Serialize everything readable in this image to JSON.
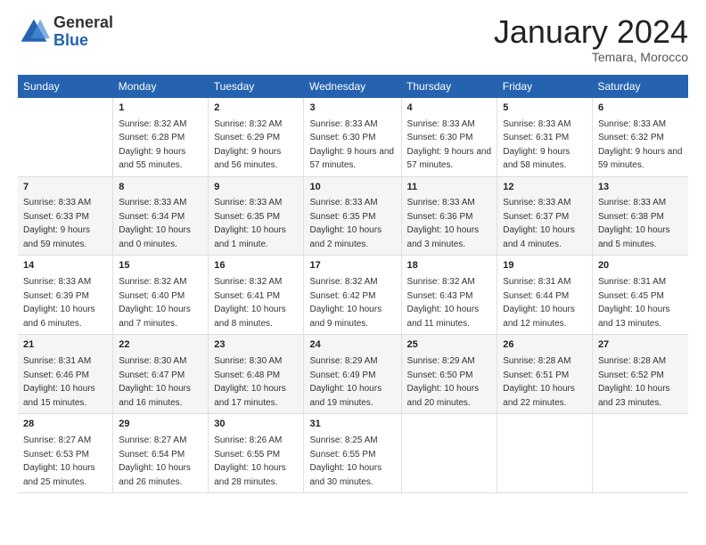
{
  "header": {
    "logo_general": "General",
    "logo_blue": "Blue",
    "month_title": "January 2024",
    "subtitle": "Temara, Morocco"
  },
  "days_of_week": [
    "Sunday",
    "Monday",
    "Tuesday",
    "Wednesday",
    "Thursday",
    "Friday",
    "Saturday"
  ],
  "weeks": [
    [
      {
        "day": "",
        "sunrise": "",
        "sunset": "",
        "daylight": ""
      },
      {
        "day": "1",
        "sunrise": "Sunrise: 8:32 AM",
        "sunset": "Sunset: 6:28 PM",
        "daylight": "Daylight: 9 hours and 55 minutes."
      },
      {
        "day": "2",
        "sunrise": "Sunrise: 8:32 AM",
        "sunset": "Sunset: 6:29 PM",
        "daylight": "Daylight: 9 hours and 56 minutes."
      },
      {
        "day": "3",
        "sunrise": "Sunrise: 8:33 AM",
        "sunset": "Sunset: 6:30 PM",
        "daylight": "Daylight: 9 hours and 57 minutes."
      },
      {
        "day": "4",
        "sunrise": "Sunrise: 8:33 AM",
        "sunset": "Sunset: 6:30 PM",
        "daylight": "Daylight: 9 hours and 57 minutes."
      },
      {
        "day": "5",
        "sunrise": "Sunrise: 8:33 AM",
        "sunset": "Sunset: 6:31 PM",
        "daylight": "Daylight: 9 hours and 58 minutes."
      },
      {
        "day": "6",
        "sunrise": "Sunrise: 8:33 AM",
        "sunset": "Sunset: 6:32 PM",
        "daylight": "Daylight: 9 hours and 59 minutes."
      }
    ],
    [
      {
        "day": "7",
        "sunrise": "Sunrise: 8:33 AM",
        "sunset": "Sunset: 6:33 PM",
        "daylight": "Daylight: 9 hours and 59 minutes."
      },
      {
        "day": "8",
        "sunrise": "Sunrise: 8:33 AM",
        "sunset": "Sunset: 6:34 PM",
        "daylight": "Daylight: 10 hours and 0 minutes."
      },
      {
        "day": "9",
        "sunrise": "Sunrise: 8:33 AM",
        "sunset": "Sunset: 6:35 PM",
        "daylight": "Daylight: 10 hours and 1 minute."
      },
      {
        "day": "10",
        "sunrise": "Sunrise: 8:33 AM",
        "sunset": "Sunset: 6:35 PM",
        "daylight": "Daylight: 10 hours and 2 minutes."
      },
      {
        "day": "11",
        "sunrise": "Sunrise: 8:33 AM",
        "sunset": "Sunset: 6:36 PM",
        "daylight": "Daylight: 10 hours and 3 minutes."
      },
      {
        "day": "12",
        "sunrise": "Sunrise: 8:33 AM",
        "sunset": "Sunset: 6:37 PM",
        "daylight": "Daylight: 10 hours and 4 minutes."
      },
      {
        "day": "13",
        "sunrise": "Sunrise: 8:33 AM",
        "sunset": "Sunset: 6:38 PM",
        "daylight": "Daylight: 10 hours and 5 minutes."
      }
    ],
    [
      {
        "day": "14",
        "sunrise": "Sunrise: 8:33 AM",
        "sunset": "Sunset: 6:39 PM",
        "daylight": "Daylight: 10 hours and 6 minutes."
      },
      {
        "day": "15",
        "sunrise": "Sunrise: 8:32 AM",
        "sunset": "Sunset: 6:40 PM",
        "daylight": "Daylight: 10 hours and 7 minutes."
      },
      {
        "day": "16",
        "sunrise": "Sunrise: 8:32 AM",
        "sunset": "Sunset: 6:41 PM",
        "daylight": "Daylight: 10 hours and 8 minutes."
      },
      {
        "day": "17",
        "sunrise": "Sunrise: 8:32 AM",
        "sunset": "Sunset: 6:42 PM",
        "daylight": "Daylight: 10 hours and 9 minutes."
      },
      {
        "day": "18",
        "sunrise": "Sunrise: 8:32 AM",
        "sunset": "Sunset: 6:43 PM",
        "daylight": "Daylight: 10 hours and 11 minutes."
      },
      {
        "day": "19",
        "sunrise": "Sunrise: 8:31 AM",
        "sunset": "Sunset: 6:44 PM",
        "daylight": "Daylight: 10 hours and 12 minutes."
      },
      {
        "day": "20",
        "sunrise": "Sunrise: 8:31 AM",
        "sunset": "Sunset: 6:45 PM",
        "daylight": "Daylight: 10 hours and 13 minutes."
      }
    ],
    [
      {
        "day": "21",
        "sunrise": "Sunrise: 8:31 AM",
        "sunset": "Sunset: 6:46 PM",
        "daylight": "Daylight: 10 hours and 15 minutes."
      },
      {
        "day": "22",
        "sunrise": "Sunrise: 8:30 AM",
        "sunset": "Sunset: 6:47 PM",
        "daylight": "Daylight: 10 hours and 16 minutes."
      },
      {
        "day": "23",
        "sunrise": "Sunrise: 8:30 AM",
        "sunset": "Sunset: 6:48 PM",
        "daylight": "Daylight: 10 hours and 17 minutes."
      },
      {
        "day": "24",
        "sunrise": "Sunrise: 8:29 AM",
        "sunset": "Sunset: 6:49 PM",
        "daylight": "Daylight: 10 hours and 19 minutes."
      },
      {
        "day": "25",
        "sunrise": "Sunrise: 8:29 AM",
        "sunset": "Sunset: 6:50 PM",
        "daylight": "Daylight: 10 hours and 20 minutes."
      },
      {
        "day": "26",
        "sunrise": "Sunrise: 8:28 AM",
        "sunset": "Sunset: 6:51 PM",
        "daylight": "Daylight: 10 hours and 22 minutes."
      },
      {
        "day": "27",
        "sunrise": "Sunrise: 8:28 AM",
        "sunset": "Sunset: 6:52 PM",
        "daylight": "Daylight: 10 hours and 23 minutes."
      }
    ],
    [
      {
        "day": "28",
        "sunrise": "Sunrise: 8:27 AM",
        "sunset": "Sunset: 6:53 PM",
        "daylight": "Daylight: 10 hours and 25 minutes."
      },
      {
        "day": "29",
        "sunrise": "Sunrise: 8:27 AM",
        "sunset": "Sunset: 6:54 PM",
        "daylight": "Daylight: 10 hours and 26 minutes."
      },
      {
        "day": "30",
        "sunrise": "Sunrise: 8:26 AM",
        "sunset": "Sunset: 6:55 PM",
        "daylight": "Daylight: 10 hours and 28 minutes."
      },
      {
        "day": "31",
        "sunrise": "Sunrise: 8:25 AM",
        "sunset": "Sunset: 6:55 PM",
        "daylight": "Daylight: 10 hours and 30 minutes."
      },
      {
        "day": "",
        "sunrise": "",
        "sunset": "",
        "daylight": ""
      },
      {
        "day": "",
        "sunrise": "",
        "sunset": "",
        "daylight": ""
      },
      {
        "day": "",
        "sunrise": "",
        "sunset": "",
        "daylight": ""
      }
    ]
  ]
}
